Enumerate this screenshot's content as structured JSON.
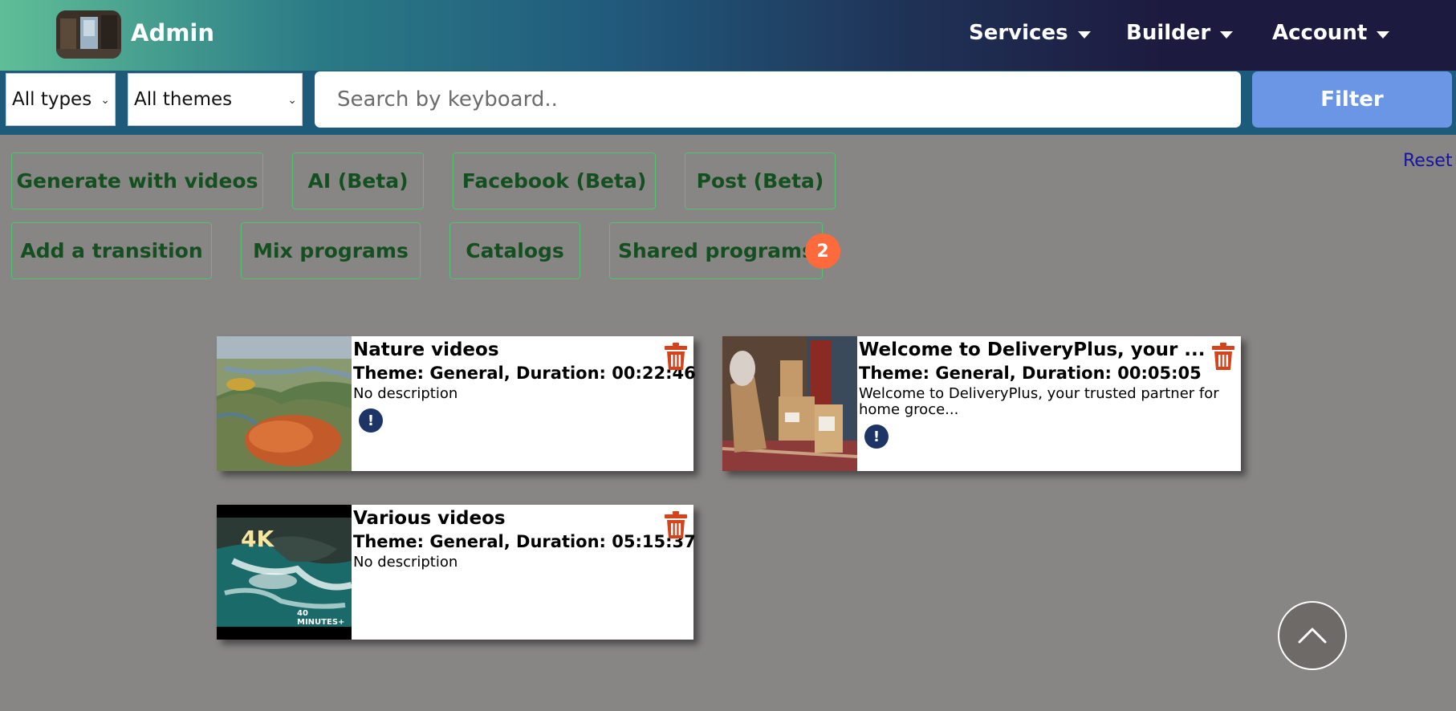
{
  "header": {
    "brand_title": "Admin",
    "nav": [
      {
        "label": "Services"
      },
      {
        "label": "Builder"
      },
      {
        "label": "Account"
      }
    ]
  },
  "filters": {
    "type_select": "All types",
    "theme_select": "All themes",
    "search_placeholder": "Search by keyboard..",
    "filter_label": "Filter",
    "reset_label": "Reset"
  },
  "actions": {
    "row1": [
      "Generate with videos",
      "AI (Beta)",
      "Facebook (Beta)",
      "Post (Beta)"
    ],
    "row2": [
      "Add a transition",
      "Mix programs",
      "Catalogs",
      "Shared programs"
    ],
    "shared_badge": "2"
  },
  "programs": [
    {
      "title": "Nature videos",
      "meta": "Theme: General, Duration: 00:22:46",
      "description": "No description",
      "thumbnail": "aerial-wetland-image",
      "info_icon": "info-icon",
      "delete_icon": "trash-icon"
    },
    {
      "title": "Welcome to DeliveryPlus, your ...",
      "meta": "Theme: General, Duration: 00:05:05",
      "description": "Welcome to DeliveryPlus, your trusted partner for home groce...",
      "thumbnail": "delivery-boxes-image",
      "info_icon": "info-icon",
      "delete_icon": "trash-icon"
    },
    {
      "title": "Various videos",
      "meta": "Theme: General, Duration: 05:15:37",
      "description": "No description",
      "thumbnail": "ocean-rocks-4k-image",
      "thumb_text_main": "4K",
      "thumb_text_sub": "40 MINUTES+",
      "delete_icon": "trash-icon"
    }
  ],
  "colors": {
    "page_bg": "#888585",
    "filter_button": "#6b96e6",
    "action_border": "#4fc36e",
    "action_text": "#134f1f",
    "badge": "#ff6a3c",
    "trash": "#d4431c",
    "info": "#1c3566"
  }
}
